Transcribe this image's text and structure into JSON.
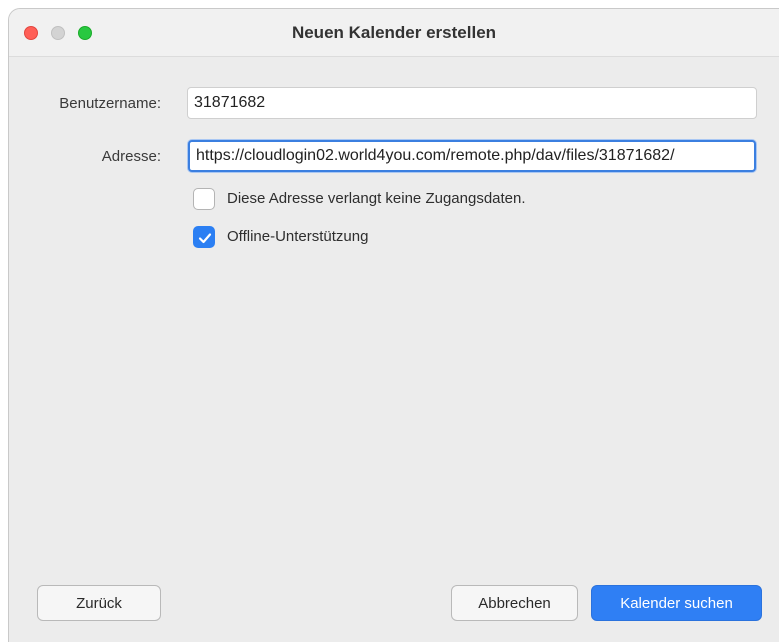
{
  "window": {
    "title": "Neuen Kalender erstellen"
  },
  "form": {
    "username_label": "Benutzername:",
    "username_value": "31871682",
    "address_label": "Adresse:",
    "address_value": "https://cloudlogin02.world4you.com/remote.php/dav/files/31871682/",
    "no_credentials_label": "Diese Adresse verlangt keine Zugangsdaten.",
    "no_credentials_checked": false,
    "offline_label": "Offline-Unterstützung",
    "offline_checked": true
  },
  "buttons": {
    "back": "Zurück",
    "cancel": "Abbrechen",
    "search": "Kalender suchen"
  },
  "colors": {
    "accent": "#2f7ff4",
    "close": "#ff5f57",
    "maximize": "#28c840"
  }
}
